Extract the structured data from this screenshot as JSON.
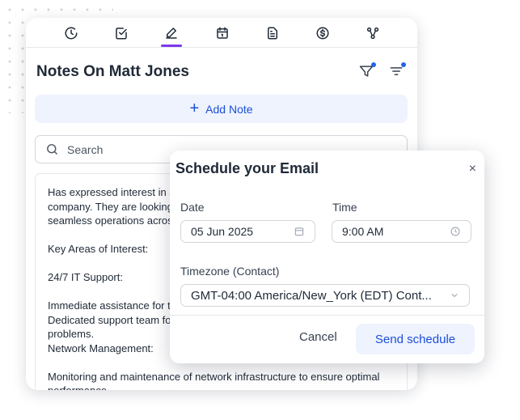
{
  "toolbar": {
    "icons": [
      "activity-icon",
      "task-check-icon",
      "note-pen-icon",
      "calendar-icon",
      "document-icon",
      "dollar-icon",
      "network-icon"
    ],
    "active": "note-pen-icon"
  },
  "notes": {
    "title": "Notes On Matt Jones",
    "add_label": "Add Note",
    "search_placeholder": "Search",
    "body": "Has expressed interest in a\ncompany. They are looking\nseamless operations acros\n\nKey Areas of Interest:\n\n24/7 IT Support:\n\nImmediate assistance for t\nDedicated support team fo\nproblems.\nNetwork Management:\n\nMonitoring and maintenance of network infrastructure to ensure optimal\nperformance"
  },
  "modal": {
    "title": "Schedule your Email",
    "close": "×",
    "date_label": "Date",
    "date_value": "05 Jun 2025",
    "time_label": "Time",
    "time_value": "9:00 AM",
    "timezone_label": "Timezone (Contact)",
    "timezone_value": "GMT-04:00 America/New_York (EDT) Cont...",
    "cancel_label": "Cancel",
    "send_label": "Send schedule"
  },
  "colors": {
    "accent": "#1d4ed8",
    "active_tab": "#7c3aed",
    "button_bg": "#eef3fe"
  }
}
